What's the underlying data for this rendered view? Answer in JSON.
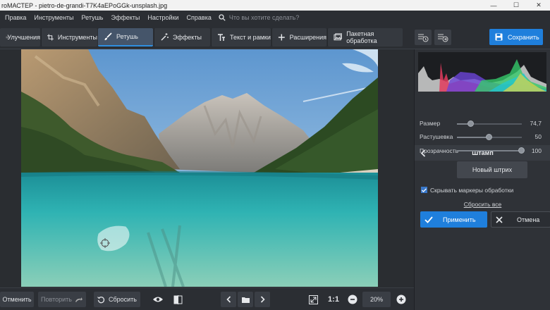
{
  "window": {
    "title": "roМАСТЕР - pietro-de-grandi-T7K4aEPoGGk-unsplash.jpg"
  },
  "menu": {
    "items": [
      "Правка",
      "Инструменты",
      "Ретушь",
      "Эффекты",
      "Настройки",
      "Справка"
    ],
    "search_placeholder": "Что вы хотите сделать?"
  },
  "toolbar": {
    "tabs": [
      "Улучшения",
      "Инструменты",
      "Ретушь",
      "Эффекты",
      "Текст и рамки",
      "Расширения",
      "Пакетная обработка"
    ],
    "active_tab": "Ретушь",
    "save_label": "Сохранить"
  },
  "panel": {
    "title": "Штамп",
    "sliders": [
      {
        "label": "Размер",
        "value": "74,7",
        "level": 0.22
      },
      {
        "label": "Растушевка",
        "value": "50",
        "level": 0.5
      },
      {
        "label": "Прозрачность",
        "value": "100",
        "level": 1.0
      }
    ],
    "new_stroke": "Новый штрих",
    "hide_markers": "Скрывать маркеры обработки",
    "hide_markers_checked": true,
    "reset_all": "Сбросить все",
    "apply": "Применить",
    "cancel": "Отмена"
  },
  "bottombar": {
    "undo": "Отменить",
    "redo": "Повторить",
    "reset": "Сбросить",
    "ratio": "1:1",
    "zoom": "20%"
  },
  "colors": {
    "accent": "#1f7fdc",
    "active_tab_bg": "#45556a",
    "panel_bg": "#2f3237"
  }
}
